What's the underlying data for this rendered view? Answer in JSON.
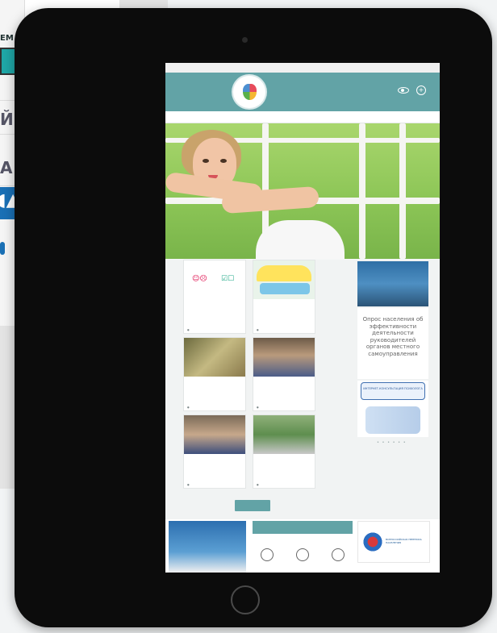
{
  "screen": {
    "title_bar_glyphs": "",
    "header": {
      "left_text": "",
      "contacts": [
        "",
        "",
        ""
      ]
    },
    "nav": [
      {
        "label": ""
      },
      {
        "label": ""
      },
      {
        "label": ""
      },
      {
        "label": ""
      },
      {
        "label": ""
      },
      {
        "label": ""
      }
    ],
    "news_cards": [
      {
        "title": "",
        "meta": "",
        "views": "",
        "date": ""
      },
      {
        "title": "",
        "meta": "",
        "views": "",
        "date": ""
      },
      {
        "title": "",
        "meta": "",
        "views": "",
        "date": ""
      },
      {
        "title": "",
        "meta": "",
        "views": "",
        "date": ""
      },
      {
        "title": "",
        "meta": "",
        "views": "",
        "date": ""
      },
      {
        "title": "",
        "meta": "",
        "views": "",
        "date": ""
      }
    ],
    "more_button": "",
    "sidebar": {
      "survey_text": "Опрос населения об эффективности деятельности руководителей органов местного самоуправления",
      "consult_button": "ИНТЕРНЕТ-КОНСУЛЬТАЦИЯ ПСИХОЛОГА"
    },
    "footer": {
      "banner_text": "",
      "section_header": "",
      "icon_labels": [
        "",
        "",
        ""
      ],
      "right_badge_text": "ВСЕРОССИЙСКАЯ ПЕРЕПИСЬ НАСЕЛЕНИЯ"
    }
  },
  "background_window": {
    "letters": [
      "ЕМ",
      "Й",
      "А"
    ]
  },
  "colors": {
    "accent": "#62a3a6",
    "tablet": "#0c0c0c"
  }
}
